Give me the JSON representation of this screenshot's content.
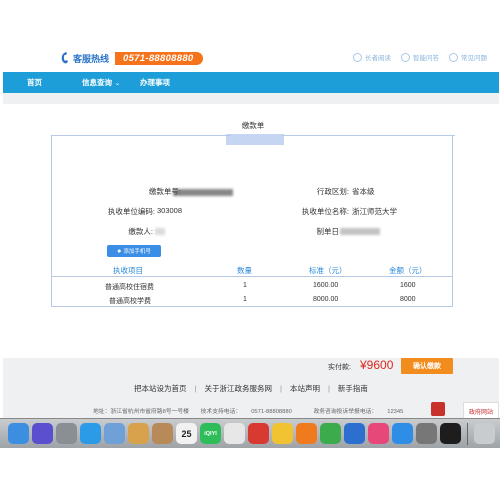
{
  "header": {
    "hotline_label": "客服热线",
    "hotline_number": "0571-88808880",
    "quicklinks": [
      {
        "label": "长者阅读",
        "icon": "reader-icon"
      },
      {
        "label": "智能问答",
        "icon": "eye-icon"
      },
      {
        "label": "常见问题",
        "icon": "help-icon"
      }
    ]
  },
  "nav": {
    "home": "首页",
    "query": "信息查询",
    "affairs": "办理事项"
  },
  "form": {
    "title": "缴款单",
    "payment_no_label": "缴款单号:",
    "region_label": "行政区划:",
    "region_value": "省本级",
    "unit_code_label": "执收单位编码:",
    "unit_code_value": "303008",
    "unit_name_label": "执收单位名称:",
    "unit_name_value": "浙江师范大学",
    "payer_label": "缴款人:",
    "date_label": "制单日",
    "add_phone_label": "添加手机号"
  },
  "table": {
    "headers": [
      "执收项目",
      "数量",
      "标准（元）",
      "金额（元）"
    ],
    "rows": [
      {
        "item": "普通高校住宿费",
        "qty": "1",
        "standard": "1600.00",
        "amount": "1600"
      },
      {
        "item": "普通高校学费",
        "qty": "1",
        "standard": "8000.00",
        "amount": "8000"
      }
    ]
  },
  "summary": {
    "total_label": "实付款:",
    "total_value": "¥9600",
    "confirm_label": "确认缴款"
  },
  "footer": {
    "links": [
      "把本站设为首页",
      "关于浙江政务服务网",
      "本站声明",
      "新手指南"
    ],
    "address": "地址：浙江省杭州市省府路8号一号楼",
    "support": "技术支持电话：",
    "support_phone": "0571-88808880",
    "complaint": "政务咨询投诉举报电话：",
    "complaint_phone": "12345",
    "badge_text": "政府网站"
  },
  "colors": {
    "nav_bg": "#1e9ed8",
    "hotline_bg": "#f5731a",
    "accent_blue": "#2a88d8",
    "price_red": "#e0261d",
    "confirm_bg": "#f28c1c"
  },
  "dock": {
    "items": [
      {
        "icon": "finder-icon",
        "color": "#3b8ee0"
      },
      {
        "icon": "siri-icon",
        "color": "#5a4fcf"
      },
      {
        "icon": "launchpad-icon",
        "color": "#8a8f96"
      },
      {
        "icon": "safari-icon",
        "color": "#2b9be8"
      },
      {
        "icon": "preview-icon",
        "color": "#6fa0d8"
      },
      {
        "icon": "notes-icon",
        "color": "#d8a24c"
      },
      {
        "icon": "contacts-icon",
        "color": "#b88a5a"
      },
      {
        "icon": "calendar-icon",
        "color": "#f2f2f2",
        "label": "25"
      },
      {
        "icon": "iqiyi-icon",
        "color": "#2ebd59",
        "label": "iQIYI"
      },
      {
        "icon": "photos-icon",
        "color": "#e7e7e7"
      },
      {
        "icon": "netease-music-icon",
        "color": "#d83a32"
      },
      {
        "icon": "qqmusic-icon",
        "color": "#f1c232"
      },
      {
        "icon": "books-icon",
        "color": "#f07b1e"
      },
      {
        "icon": "numbers-icon",
        "color": "#3cab4c"
      },
      {
        "icon": "keynote-icon",
        "color": "#2d6fcf"
      },
      {
        "icon": "itunes-icon",
        "color": "#e8477a"
      },
      {
        "icon": "appstore-icon",
        "color": "#2e8de4"
      },
      {
        "icon": "system-preferences-icon",
        "color": "#777"
      },
      {
        "icon": "qq-icon",
        "color": "#1d1d1d"
      },
      {
        "icon": "trash-icon",
        "color": "#c9cccf"
      }
    ]
  }
}
